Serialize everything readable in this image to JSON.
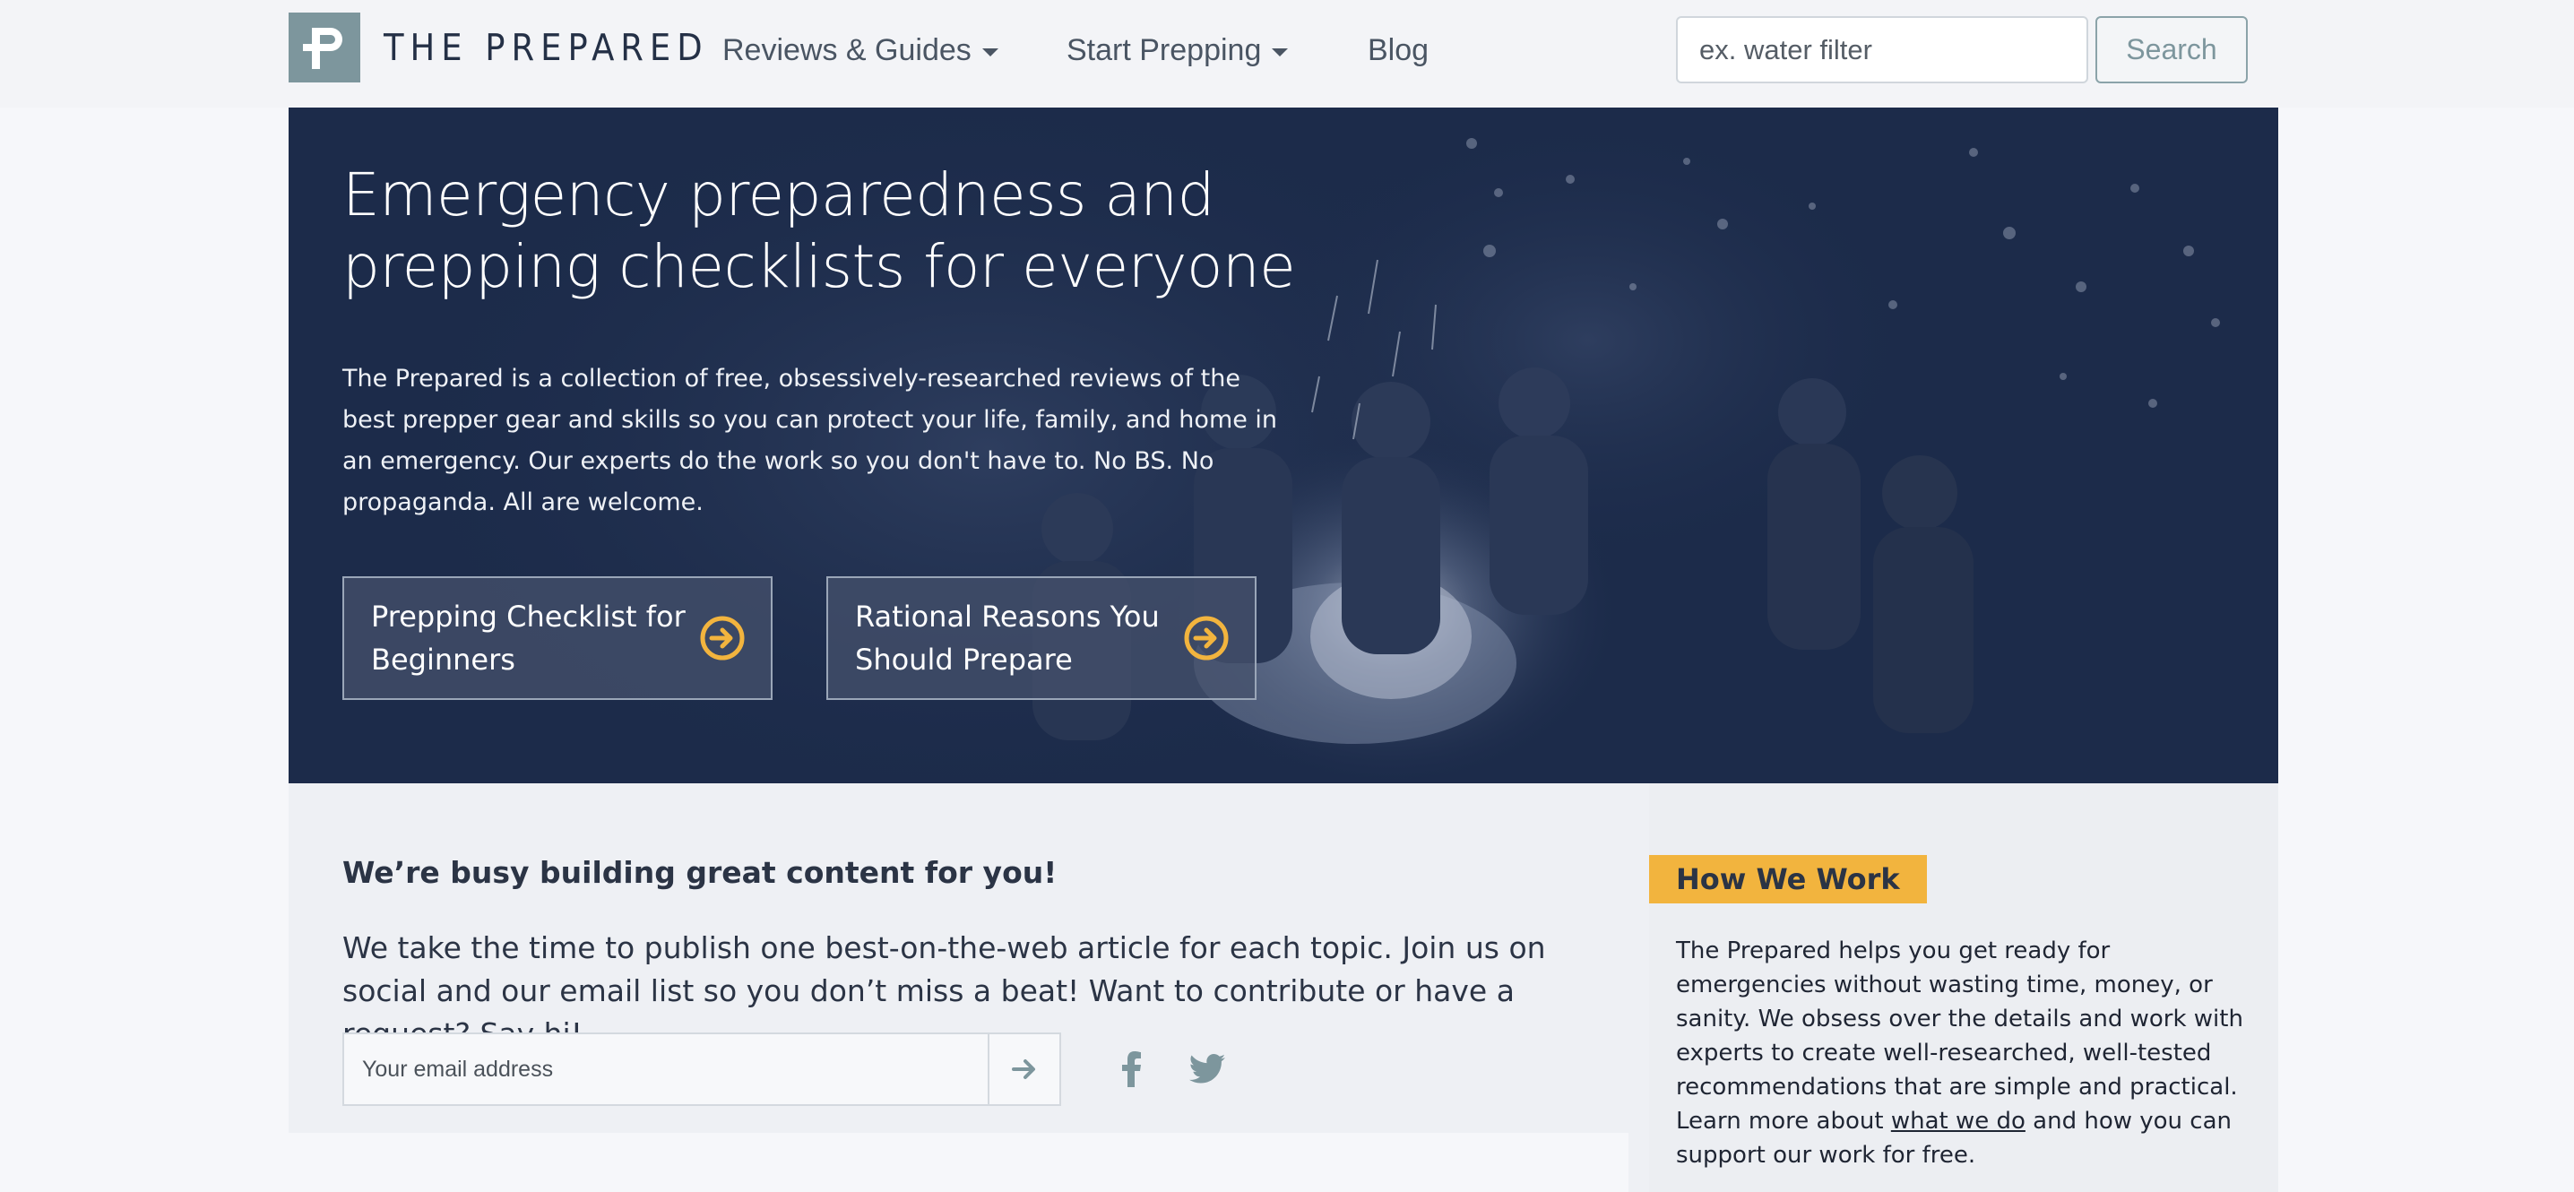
{
  "header": {
    "logo_text": "THE PREPARED",
    "nav": [
      {
        "label": "Reviews & Guides"
      },
      {
        "label": "Start Prepping"
      },
      {
        "label": "Blog"
      }
    ],
    "search": {
      "placeholder": "ex. water filter",
      "button_label": "Search"
    }
  },
  "hero": {
    "title": "Emergency preparedness and prepping checklists for everyone",
    "description": "The Prepared is a collection of free, obsessively-researched reviews of the best prepper gear and skills so you can protect your life, family, and home in an emergency. Our experts do the work so you don't have to. No BS. No propaganda. All are welcome.",
    "buttons": [
      {
        "label": "Prepping Checklist for Beginners"
      },
      {
        "label": "Rational Reasons You Should Prepare"
      }
    ]
  },
  "newsletter": {
    "title": "We’re busy building great content for you!",
    "text": "We take the time to publish one best-on-the-web article for each topic. Join us on social and our email list so you don’t miss a beat! Want to contribute or have a request? Say hi!",
    "email_placeholder": "Your email address"
  },
  "how_we_work": {
    "badge": "How We Work",
    "text_before": "The Prepared helps you get ready for emergencies without wasting time, money, or sanity. We obsess over the details and work with experts to create well-researched, well-tested recommendations that are simple and practical. Learn more about ",
    "link": "what we do",
    "text_after": " and how you can support our work for free."
  },
  "colors": {
    "hero_bg": "#1c2b4a",
    "accent": "#f2b43e",
    "logo_mark": "#7d969d"
  },
  "icons": [
    "logo-p-icon",
    "caret-down-icon",
    "arrow-right-circle-icon",
    "arrow-right-icon",
    "facebook-icon",
    "twitter-icon"
  ]
}
